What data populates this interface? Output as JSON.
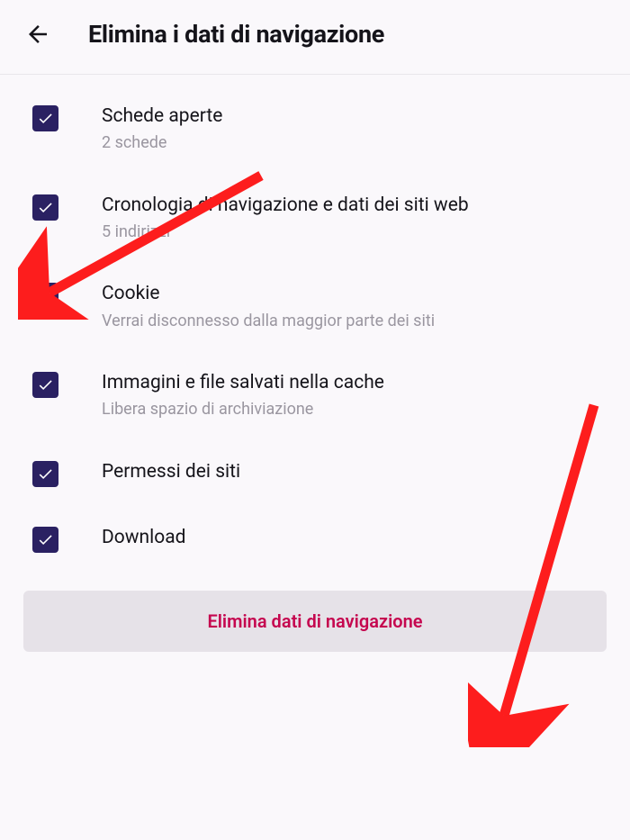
{
  "header": {
    "title": "Elimina i dati di navigazione"
  },
  "items": [
    {
      "title": "Schede aperte",
      "subtitle": "2 schede"
    },
    {
      "title": "Cronologia di navigazione e dati dei siti web",
      "subtitle": "5 indirizzi"
    },
    {
      "title": "Cookie",
      "subtitle": "Verrai disconnesso dalla maggior parte dei siti"
    },
    {
      "title": "Immagini e file salvati nella cache",
      "subtitle": "Libera spazio di archiviazione"
    },
    {
      "title": "Permessi dei siti",
      "subtitle": ""
    },
    {
      "title": "Download",
      "subtitle": ""
    }
  ],
  "deleteButton": {
    "label": "Elimina dati di navigazione"
  },
  "annotations": {
    "arrowColor": "#fd1d1d"
  }
}
